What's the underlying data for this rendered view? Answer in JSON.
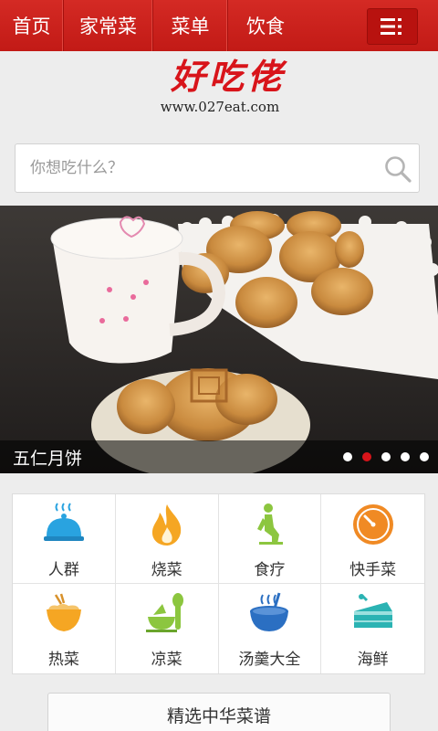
{
  "nav": {
    "items": [
      {
        "label": "首页"
      },
      {
        "label": "家常菜"
      },
      {
        "label": "菜单"
      },
      {
        "label": "饮食"
      }
    ],
    "menu_icon": "list-menu-icon"
  },
  "logo": {
    "title": "好吃佬",
    "url": "www.027eat.com"
  },
  "search": {
    "placeholder": "你想吃什么？",
    "value": "",
    "icon": "search-icon"
  },
  "banner": {
    "caption": "五仁月饼",
    "slide_count": 5,
    "active_slide": 2
  },
  "categories": [
    {
      "label": "人群",
      "icon": "food-cloche-icon",
      "color": "#29a3e0"
    },
    {
      "label": "烧菜",
      "icon": "flame-icon",
      "color": "#f5a623"
    },
    {
      "label": "食疗",
      "icon": "person-kneeling-icon",
      "color": "#8cc63f"
    },
    {
      "label": "快手菜",
      "icon": "clock-icon",
      "color": "#f08a24"
    },
    {
      "label": "热菜",
      "icon": "hot-bowl-icon",
      "color": "#f5a623"
    },
    {
      "label": "凉菜",
      "icon": "salad-plate-icon",
      "color": "#8cc63f"
    },
    {
      "label": "汤羹大全",
      "icon": "soup-bowl-icon",
      "color": "#2b6fc2"
    },
    {
      "label": "海鲜",
      "icon": "cake-slice-icon",
      "color": "#2bb3b3"
    }
  ],
  "featured_button": {
    "label": "精选中华菜谱"
  }
}
